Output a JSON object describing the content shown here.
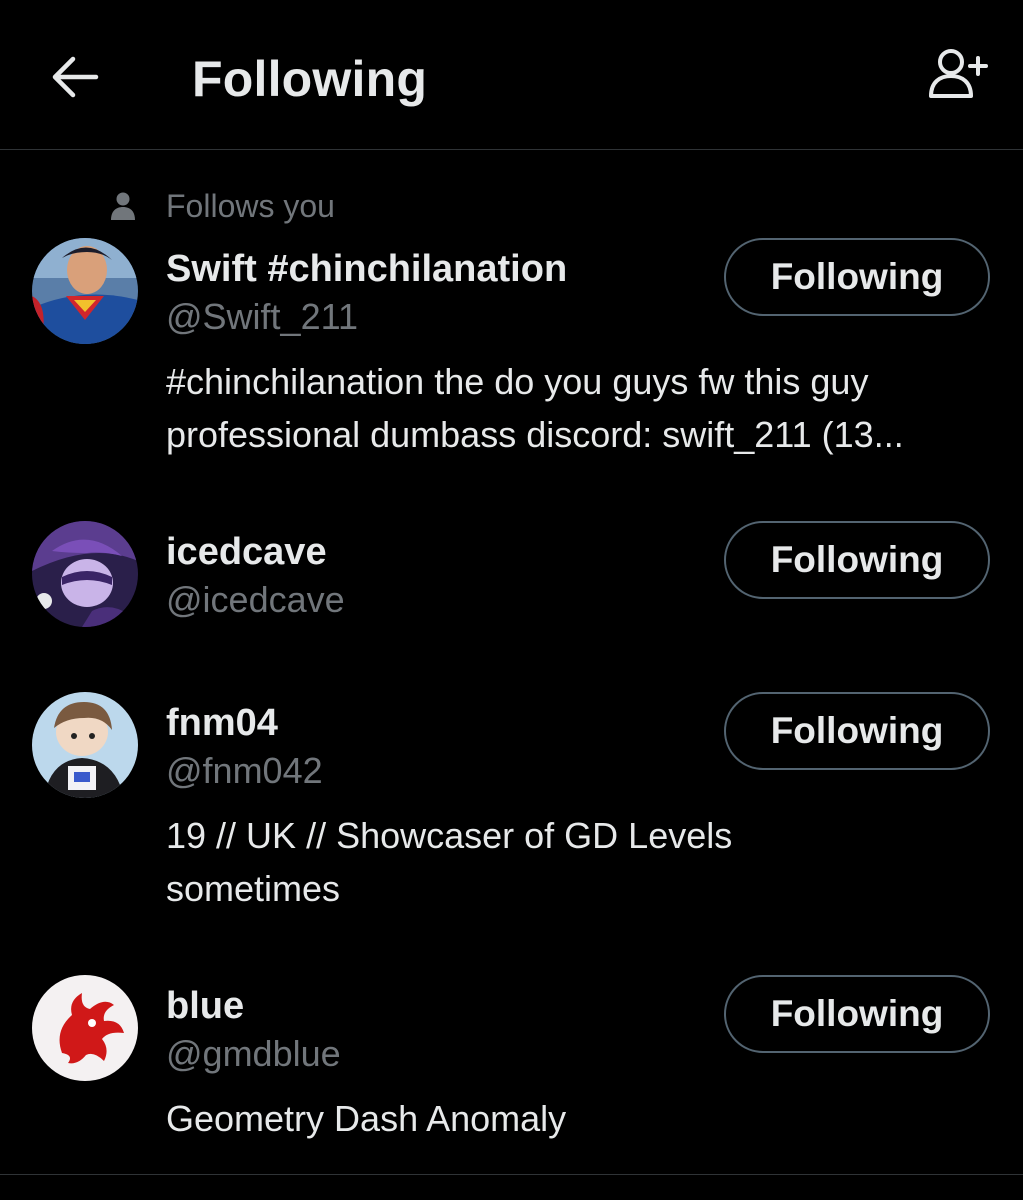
{
  "header": {
    "title": "Following",
    "back_icon": "arrow-left-icon",
    "add_icon": "user-plus-icon"
  },
  "follows_you_label": "Follows you",
  "colors": {
    "background": "#000000",
    "primary_text": "#e7e9ea",
    "secondary_text": "#71767b",
    "button_border": "#536471",
    "divider": "#2f3336"
  },
  "users": [
    {
      "name": "Swift #chinchilanation",
      "handle": "@Swift_211",
      "follows_you": true,
      "button_label": "Following",
      "bio_lines": [
        "#chinchilanation the do you guys fw this guy",
        "professional dumbass discord: swift_211 (13..."
      ]
    },
    {
      "name": "icedcave",
      "handle": "@icedcave",
      "follows_you": false,
      "button_label": "Following",
      "bio_lines": []
    },
    {
      "name": "fnm04",
      "handle": "@fnm042",
      "follows_you": false,
      "button_label": "Following",
      "bio_lines": [
        "19 // UK // Showcaser of GD Levels",
        "sometimes"
      ]
    },
    {
      "name": "blue",
      "handle": "@gmdblue",
      "follows_you": false,
      "button_label": "Following",
      "bio_lines": [
        "Geometry Dash Anomaly"
      ]
    }
  ]
}
